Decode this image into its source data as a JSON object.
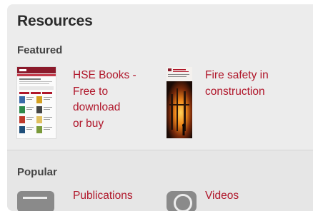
{
  "resources": {
    "title": "Resources",
    "featured_label": "Featured",
    "featured": [
      {
        "lines": [
          "HSE Books -",
          "Free to",
          "download",
          "or buy"
        ],
        "thumb_icon": "hse-books-webpage-thumbnail"
      },
      {
        "lines": [
          "Fire safety in",
          "construction"
        ],
        "thumb_icon": "fire-safety-cover-thumbnail"
      }
    ],
    "popular_label": "Popular",
    "popular": [
      {
        "label": "Publications",
        "icon": "publications-icon"
      },
      {
        "label": "Videos",
        "icon": "videos-icon"
      }
    ]
  },
  "colors": {
    "panel_bg": "#ececec",
    "link": "#b0162a",
    "heading": "#2b2b2b",
    "brand": "#8b1a2b"
  }
}
